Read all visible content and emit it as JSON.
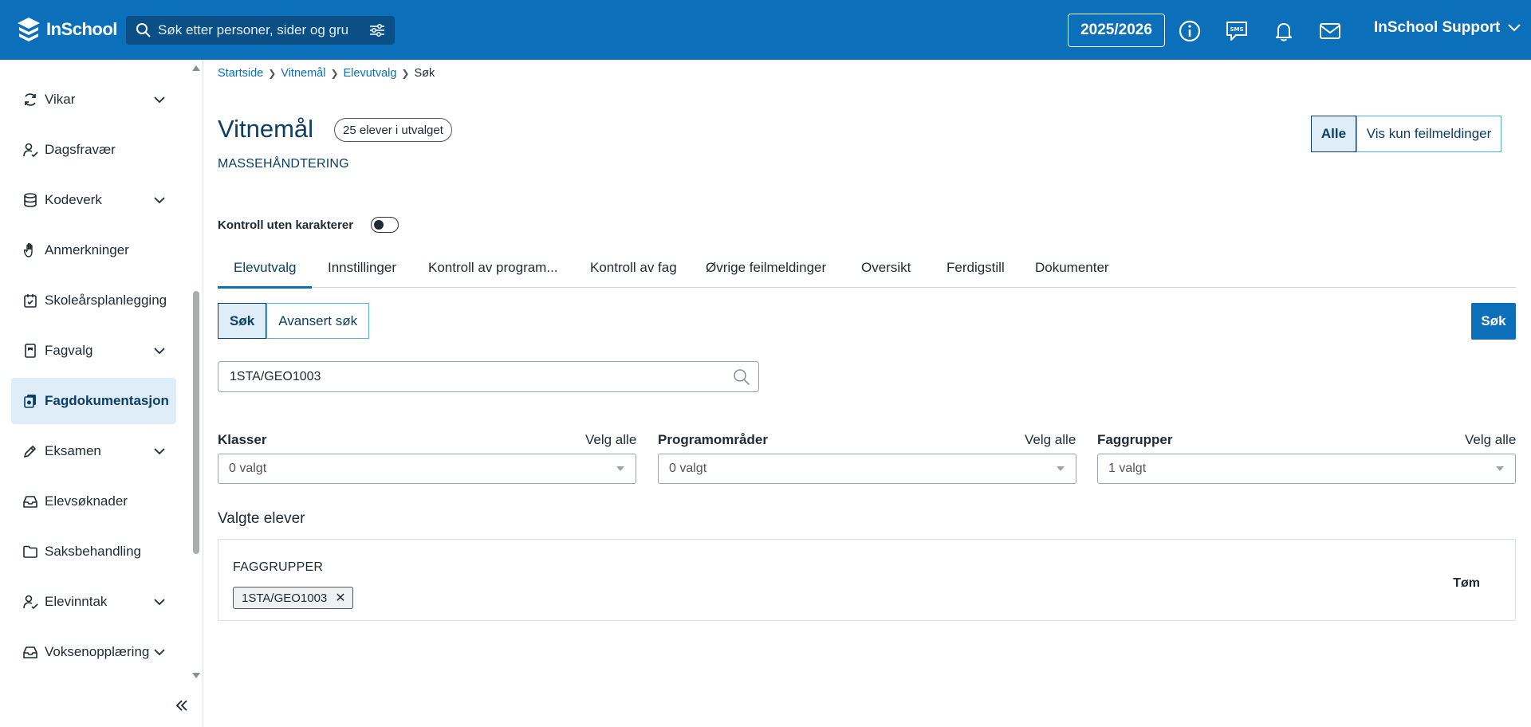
{
  "header": {
    "logo_text": "InSchool",
    "search_placeholder": "Søk etter personer, sider og gru",
    "school_year": "2025/2026",
    "user_name": "InSchool Support"
  },
  "sidebar": {
    "items": [
      {
        "label": "Vikar",
        "icon": "refresh-icon",
        "expandable": true
      },
      {
        "label": "Dagsfravær",
        "icon": "user-check-icon",
        "expandable": false
      },
      {
        "label": "Kodeverk",
        "icon": "database-icon",
        "expandable": true
      },
      {
        "label": "Anmerkninger",
        "icon": "hand-icon",
        "expandable": false
      },
      {
        "label": "Skoleårsplanlegging",
        "icon": "calendar-check-icon",
        "expandable": false
      },
      {
        "label": "Fagvalg",
        "icon": "book-icon",
        "expandable": true
      },
      {
        "label": "Fagdokumentasjon",
        "icon": "documents-icon",
        "expandable": false,
        "active": true
      },
      {
        "label": "Eksamen",
        "icon": "pencil-icon",
        "expandable": true
      },
      {
        "label": "Elevsøknader",
        "icon": "inbox-icon",
        "expandable": false
      },
      {
        "label": "Saksbehandling",
        "icon": "folder-icon",
        "expandable": false
      },
      {
        "label": "Elevinntak",
        "icon": "user-check-icon",
        "expandable": true
      },
      {
        "label": "Voksenopplæring",
        "icon": "inbox-icon",
        "expandable": true
      }
    ]
  },
  "breadcrumb": {
    "items": [
      "Startside",
      "Vitnemål",
      "Elevutvalg"
    ],
    "current": "Søk"
  },
  "page": {
    "title": "Vitnemål",
    "count_badge": "25 elever i utvalget",
    "subtitle": "MASSEHÅNDTERING",
    "view_toggle": {
      "all": "Alle",
      "errors_only": "Vis kun feilmeldinger",
      "selected": "Alle"
    },
    "control_toggle_label": "Kontroll uten karakterer",
    "control_toggle_on": false
  },
  "tabs": [
    "Elevutvalg",
    "Innstillinger",
    "Kontroll av program...",
    "Kontroll av fag",
    "Øvrige feilmeldinger",
    "Oversikt",
    "Ferdigstill",
    "Dokumenter"
  ],
  "active_tab": "Elevutvalg",
  "search_modes": {
    "simple": "Søk",
    "advanced": "Avansert søk",
    "selected": "Søk"
  },
  "search_button": "Søk",
  "query_value": "1STA/GEO1003",
  "filters": [
    {
      "label": "Klasser",
      "select_all": "Velg alle",
      "value": "0 valgt"
    },
    {
      "label": "Programområder",
      "select_all": "Velg alle",
      "value": "0 valgt"
    },
    {
      "label": "Faggrupper",
      "select_all": "Velg alle",
      "value": "1 valgt"
    }
  ],
  "selected": {
    "heading": "Valgte elever",
    "group_label": "FAGGRUPPER",
    "chips": [
      "1STA/GEO1003"
    ],
    "clear_label": "Tøm"
  },
  "colors": {
    "header_bg": "#0b6fba",
    "search_bg": "#0a4f86",
    "active_nav_bg": "#deedf8",
    "primary": "#0b6fba",
    "title_color": "#0c3e66"
  }
}
